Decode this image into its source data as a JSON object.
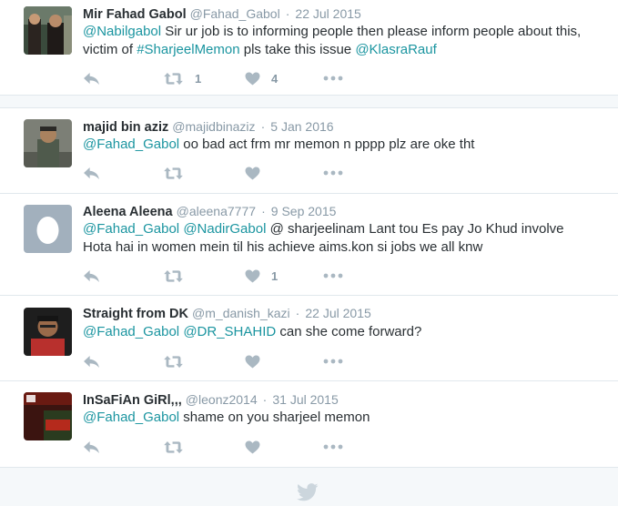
{
  "tweets": [
    {
      "name": "Mir Fahad Gabol",
      "handle": "@Fahad_Gabol",
      "time": "22 Jul 2015",
      "text_parts": [
        "@Nabilgabol",
        " Sir ur job is to informing people then please inform people about this, victim of ",
        "#SharjeelMemon",
        " pls take this issue ",
        "@KlasraRauf"
      ],
      "retweets": "1",
      "likes": "4"
    },
    {
      "name": "majid bin aziz",
      "handle": "@majidbinaziz",
      "time": "5 Jan 2016",
      "text_parts": [
        "@Fahad_Gabol",
        " oo bad act frm mr memon n pppp plz are oke tht"
      ],
      "retweets": "",
      "likes": ""
    },
    {
      "name": "Aleena Aleena",
      "handle": "@aleena7777",
      "time": "9 Sep 2015",
      "text_parts": [
        "@Fahad_Gabol",
        " ",
        "@NadirGabol",
        " @ sharjeelinam Lant tou Es pay Jo Khud involve Hota hai in women mein til his achieve aims.kon si jobs we all knw"
      ],
      "retweets": "",
      "likes": "1"
    },
    {
      "name": "Straight from DK",
      "handle": "@m_danish_kazi",
      "time": "22 Jul 2015",
      "text_parts": [
        "@Fahad_Gabol",
        " ",
        "@DR_SHAHID",
        " can she come forward?"
      ],
      "retweets": "",
      "likes": ""
    },
    {
      "name": "InSaFiAn GiRl,,,",
      "handle": "@leonz2014",
      "time": "31 Jul 2015",
      "text_parts": [
        "@Fahad_Gabol",
        " shame on you sharjeel memon"
      ],
      "retweets": "",
      "likes": ""
    }
  ],
  "colors": {
    "link": "#1b95a0",
    "icon": "#aab8c2",
    "meta": "#8899a6"
  },
  "icons": [
    "reply-icon",
    "retweet-icon",
    "heart-icon",
    "more-icon",
    "twitter-bird-icon",
    "default-egg-avatar"
  ]
}
